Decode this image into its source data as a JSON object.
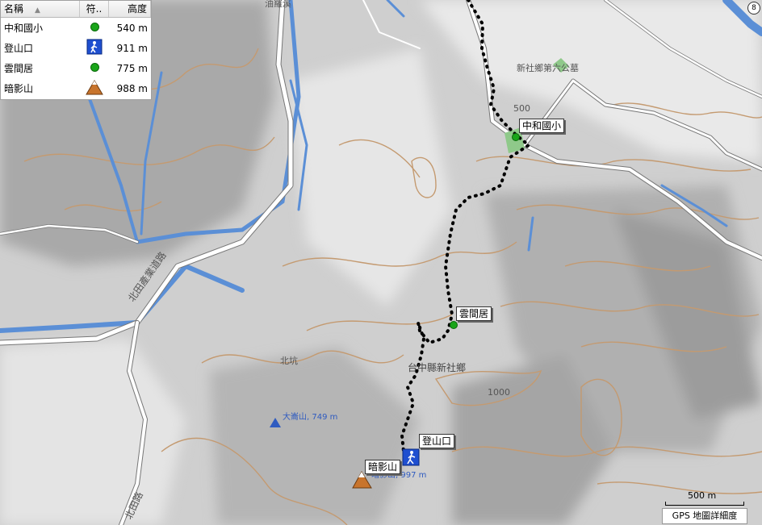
{
  "legend": {
    "headers": {
      "name": "名稱",
      "symbol": "符..",
      "elevation": "高度"
    },
    "rows": [
      {
        "name": "中和國小",
        "symbol": "green-dot",
        "elevation": "540 m"
      },
      {
        "name": "登山口",
        "symbol": "hiker",
        "elevation": "911 m"
      },
      {
        "name": "雲間居",
        "symbol": "green-dot",
        "elevation": "775 m"
      },
      {
        "name": "暗影山",
        "symbol": "mountain",
        "elevation": "988 m"
      }
    ]
  },
  "map": {
    "waypoint_labels": [
      "中和國小",
      "雲間居",
      "登山口",
      "暗影山"
    ],
    "place_labels": {
      "top": "油羅溪",
      "cemetery": "新社鄉第六公墓",
      "town": "台中縣新社鄉",
      "beikeng": "北坑",
      "daluan": "大崙山, 749 m",
      "anying_peak": "暗影山, 997 m",
      "road1": "北田產業道路",
      "road2": "北田路"
    },
    "contours": {
      "c500": "500",
      "c1000": "1000"
    },
    "corner_badge": "8",
    "colors": {
      "track": "#000000",
      "water": "#5b8fd6",
      "contour": "#c49a70",
      "road": "#ffffff",
      "waypoint": "#1aa51a"
    }
  },
  "scale": {
    "label": "500 m",
    "footer": "GPS 地圖詳細度"
  }
}
